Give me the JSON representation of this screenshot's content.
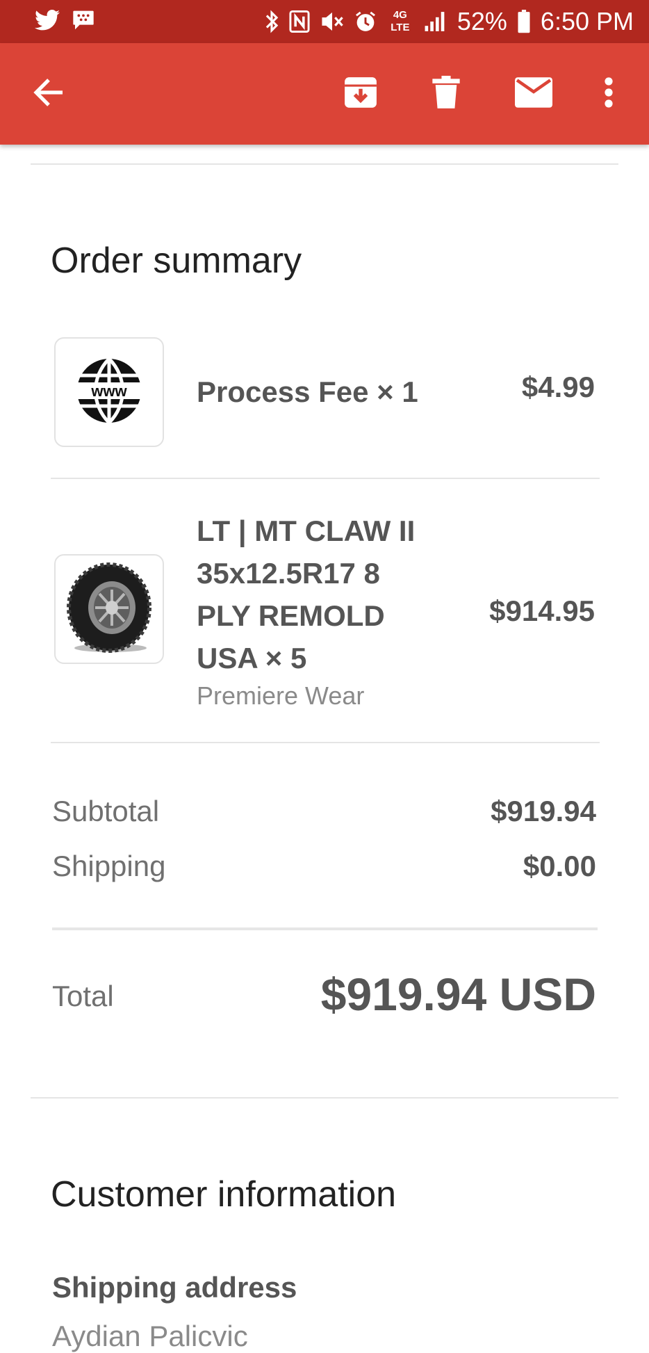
{
  "status_bar": {
    "battery": "52%",
    "time": "6:50 PM",
    "network": "4G LTE",
    "icons": [
      "twitter-icon",
      "bbm-icon",
      "bluetooth-icon",
      "nfc-icon",
      "mute-icon",
      "alarm-icon",
      "signal-icon",
      "battery-icon"
    ]
  },
  "app_bar": {
    "color": "#db4437",
    "actions": [
      "back-arrow-icon",
      "archive-icon",
      "delete-icon",
      "mark-unread-icon",
      "more-vert-icon"
    ]
  },
  "order_summary": {
    "title": "Order summary",
    "items": [
      {
        "name": "Process Fee × 1",
        "price": "$4.99",
        "vendor": "",
        "image": "www-globe-icon"
      },
      {
        "name_lines": [
          "LT | MT CLAW II",
          "35x12.5R17 8",
          "PLY REMOLD",
          "USA × 5"
        ],
        "price": "$914.95",
        "vendor": "Premiere Wear",
        "image": "tire-image"
      }
    ],
    "subtotal_label": "Subtotal",
    "subtotal_value": "$919.94",
    "shipping_label": "Shipping",
    "shipping_value": "$0.00",
    "total_label": "Total",
    "total_value": "$919.94 USD"
  },
  "customer_information": {
    "title": "Customer information",
    "shipping_address_label": "Shipping address",
    "shipping_address_first_line": "Aydian Palicvic"
  }
}
